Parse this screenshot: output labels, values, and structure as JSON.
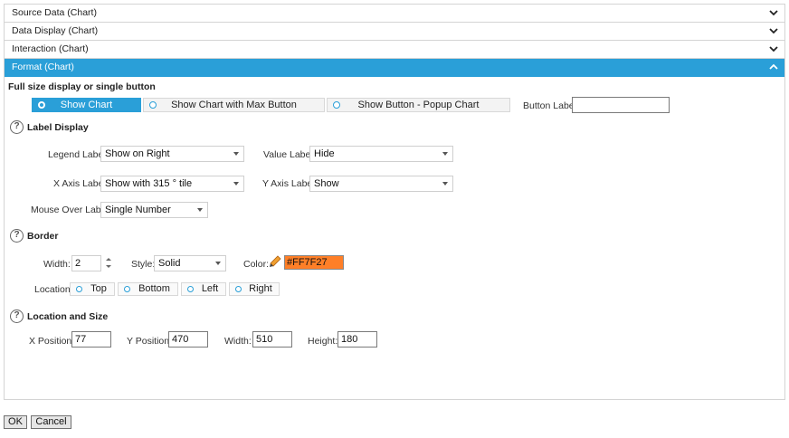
{
  "accordion": [
    {
      "label": "Source Data (Chart)",
      "expanded": false
    },
    {
      "label": "Data Display (Chart)",
      "expanded": false
    },
    {
      "label": "Interaction (Chart)",
      "expanded": false
    },
    {
      "label": "Format (Chart)",
      "expanded": true
    }
  ],
  "format": {
    "display_mode_title": "Full size display or single button",
    "display_modes": [
      {
        "label": "Show Chart",
        "selected": true
      },
      {
        "label": "Show Chart with Max Button",
        "selected": false
      },
      {
        "label": "Show Button - Popup Chart",
        "selected": false
      }
    ],
    "button_label": {
      "label": "Button Label",
      "value": ""
    },
    "label_display": {
      "title": "Label Display",
      "legend_label": {
        "label": "Legend Label",
        "value": "Show on Right"
      },
      "value_label": {
        "label": "Value Label",
        "value": "Hide"
      },
      "x_axis_label": {
        "label": "X Axis Label",
        "value": "Show with 315 ° tile"
      },
      "y_axis_label": {
        "label": "Y Axis Label",
        "value": "Show"
      },
      "mouse_over_label": {
        "label": "Mouse Over Label",
        "value": "Single Number"
      }
    },
    "border": {
      "title": "Border",
      "width": {
        "label": "Width:",
        "value": "2"
      },
      "style": {
        "label": "Style:",
        "value": "Solid"
      },
      "color": {
        "label": "Color:",
        "value": "#FF7F27"
      },
      "location_label": "Location",
      "locations": [
        {
          "label": "Top"
        },
        {
          "label": "Bottom"
        },
        {
          "label": "Left"
        },
        {
          "label": "Right"
        }
      ]
    },
    "location_size": {
      "title": "Location and Size",
      "x_position": {
        "label": "X Position:",
        "value": "77"
      },
      "y_position": {
        "label": "Y Position:",
        "value": "470"
      },
      "width": {
        "label": "Width:",
        "value": "510"
      },
      "height": {
        "label": "Height:",
        "value": "180"
      }
    }
  },
  "footer": {
    "ok_label": "OK",
    "cancel_label": "Cancel"
  },
  "colors": {
    "accent": "#2a9fd8",
    "border_color_swatch": "#FF7F27"
  },
  "icons": {
    "collapsed": "chevron-down-icon",
    "expanded": "chevron-up-icon",
    "help": "help-circle-icon",
    "color_picker": "pencil-icon"
  }
}
